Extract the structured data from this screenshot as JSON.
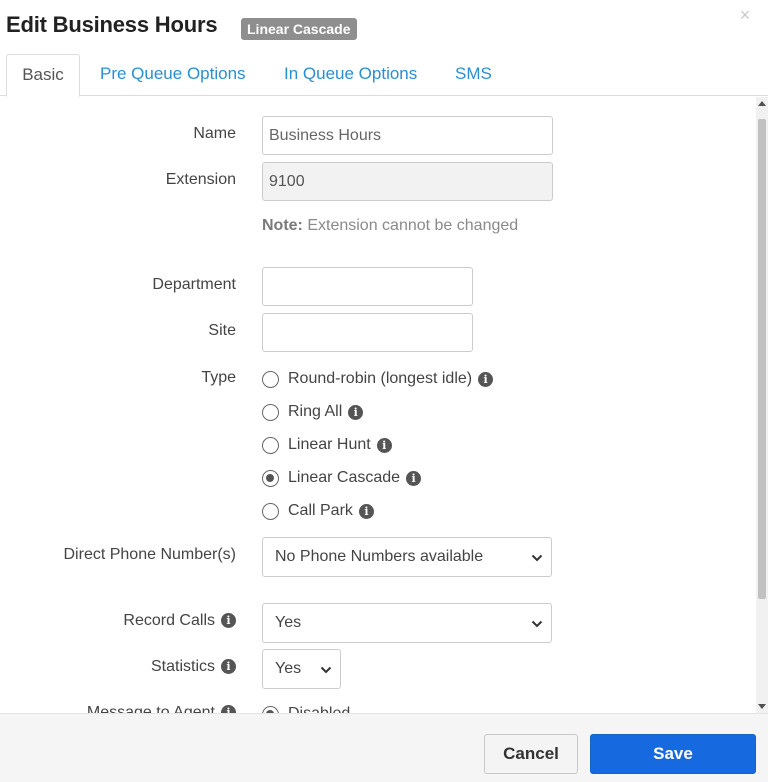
{
  "dialog": {
    "title": "Edit Business Hours",
    "badge": "Linear Cascade",
    "close_symbol": "×"
  },
  "tabs": [
    {
      "label": "Basic",
      "active": true
    },
    {
      "label": "Pre Queue Options",
      "active": false
    },
    {
      "label": "In Queue Options",
      "active": false
    },
    {
      "label": "SMS",
      "active": false
    }
  ],
  "form": {
    "name": {
      "label": "Name",
      "value": "Business Hours"
    },
    "extension": {
      "label": "Extension",
      "value": "9100"
    },
    "note": {
      "bold": "Note:",
      "text": " Extension cannot be changed"
    },
    "department": {
      "label": "Department",
      "value": ""
    },
    "site": {
      "label": "Site",
      "value": ""
    },
    "type": {
      "label": "Type",
      "options": [
        {
          "label": "Round-robin (longest idle)",
          "checked": false
        },
        {
          "label": "Ring All",
          "checked": false
        },
        {
          "label": "Linear Hunt",
          "checked": false
        },
        {
          "label": "Linear Cascade",
          "checked": true
        },
        {
          "label": "Call Park",
          "checked": false
        }
      ]
    },
    "direct_phone": {
      "label": "Direct Phone Number(s)",
      "value": "No Phone Numbers available"
    },
    "record_calls": {
      "label": "Record Calls",
      "value": "Yes"
    },
    "statistics": {
      "label": "Statistics",
      "value": "Yes"
    },
    "message_to_agent": {
      "label": "Message to Agent",
      "value": "Disabled"
    }
  },
  "footer": {
    "cancel_label": "Cancel",
    "save_label": "Save"
  },
  "icons": {
    "info_glyph": "i"
  },
  "colors": {
    "link": "#2a8fd0",
    "primary": "#1769e0",
    "badge": "#8e8e8e"
  }
}
